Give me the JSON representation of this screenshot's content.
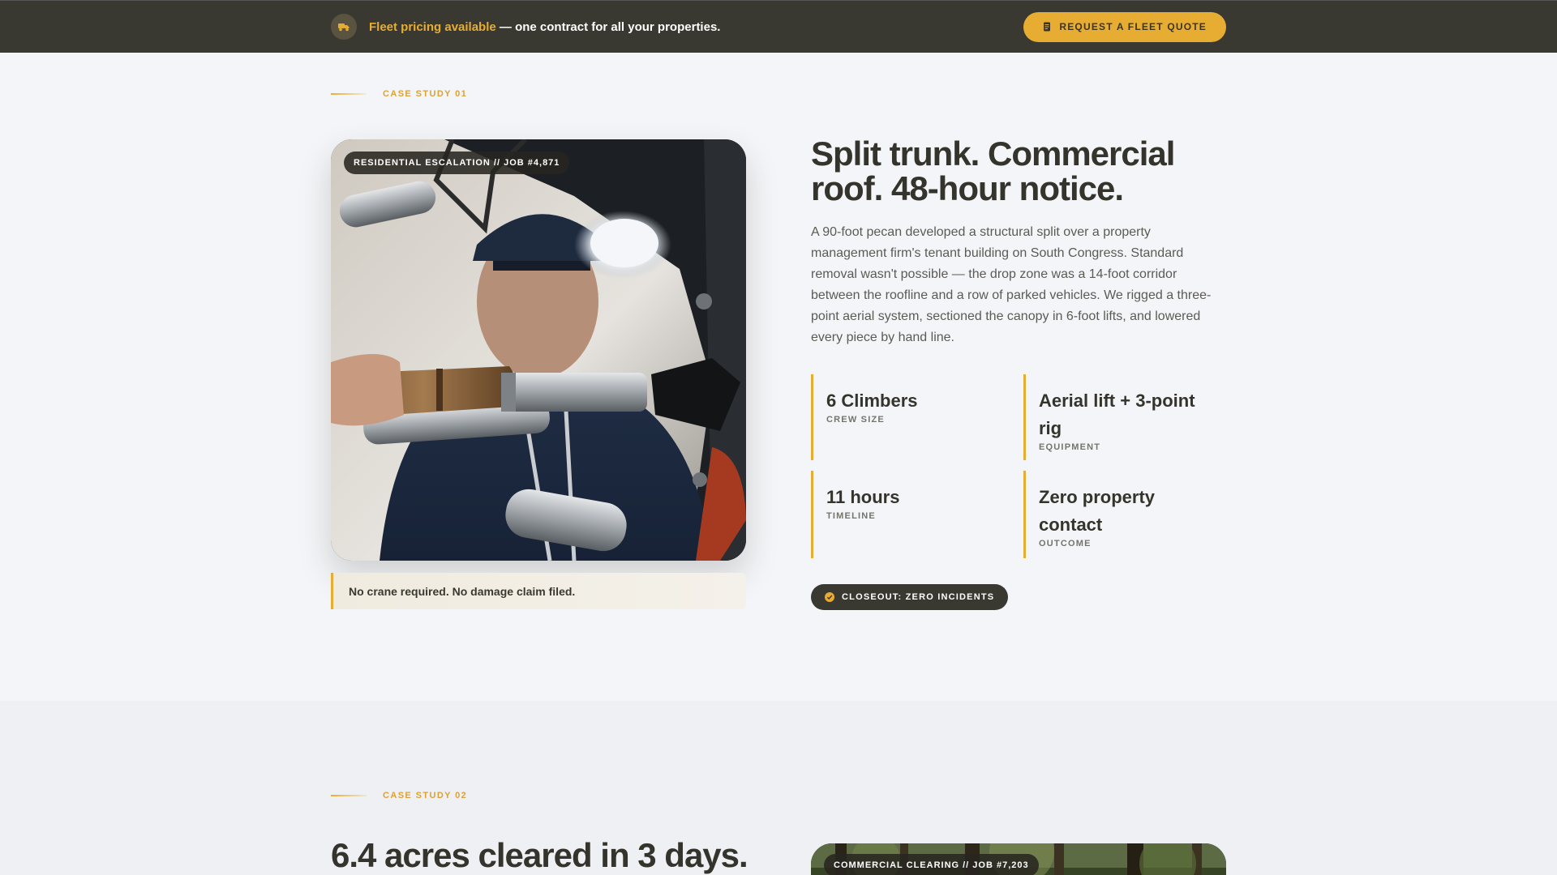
{
  "banner": {
    "icon": "truck-icon",
    "accent_text": "Fleet pricing available",
    "text": "— one contract for all your properties.",
    "button_label": "REQUEST A FLEET QUOTE",
    "button_icon": "document-icon"
  },
  "case1": {
    "eyebrow": "CASE STUDY 01",
    "image_tag": "RESIDENTIAL ESCALATION // JOB #4,871",
    "callout": "No crane required. No damage claim filed.",
    "title": "Split trunk. Commercial roof. 48-hour notice.",
    "body": "A 90-foot pecan developed a structural split over a property management firm's tenant building on South Congress. Standard removal wasn't possible — the drop zone was a 14-foot corridor between the roofline and a row of parked vehicles. We rigged a three-point aerial system, sectioned the canopy in 6-foot lifts, and lowered every piece by hand line.",
    "stats": [
      {
        "value": "6 Climbers",
        "label": "CREW SIZE"
      },
      {
        "value": "Aerial lift + 3-point rig",
        "label": "EQUIPMENT"
      },
      {
        "value": "11 hours",
        "label": "TIMELINE"
      },
      {
        "value": "Zero property contact",
        "label": "OUTCOME"
      }
    ],
    "closeout": "CLOSEOUT: ZERO INCIDENTS"
  },
  "case2": {
    "eyebrow": "CASE STUDY 02",
    "title": "6.4 acres cleared in 3 days.",
    "image_tag": "COMMERCIAL CLEARING // JOB #7,203"
  },
  "colors": {
    "accent": "#e7ad33",
    "dark": "#3a3931",
    "background": "#f3f5f8"
  }
}
